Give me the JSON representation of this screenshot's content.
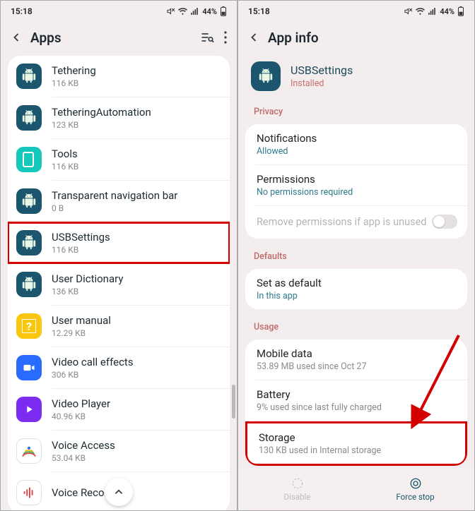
{
  "status": {
    "time": "15:18",
    "battery": "44%"
  },
  "left": {
    "title": "Apps",
    "apps": [
      {
        "name": "Tethering",
        "sub": "116 KB",
        "iconType": "android"
      },
      {
        "name": "TetheringAutomation",
        "sub": "123 KB",
        "iconType": "android"
      },
      {
        "name": "Tools",
        "sub": "116 KB",
        "iconType": "tools"
      },
      {
        "name": "Transparent navigation bar",
        "sub": "0 B",
        "iconType": "android"
      },
      {
        "name": "USBSettings",
        "sub": "116 KB",
        "iconType": "android",
        "highlight": true
      },
      {
        "name": "User Dictionary",
        "sub": "136 KB",
        "iconType": "android"
      },
      {
        "name": "User manual",
        "sub": "12.29 KB",
        "iconType": "um"
      },
      {
        "name": "Video call effects",
        "sub": "306 KB",
        "iconType": "vc"
      },
      {
        "name": "Video Player",
        "sub": "40.96 KB",
        "iconType": "vp"
      },
      {
        "name": "Voice Access",
        "sub": "53.04 KB",
        "iconType": "va"
      },
      {
        "name": "Voice Recorder",
        "sub": "",
        "iconType": "vr"
      }
    ]
  },
  "right": {
    "title": "App info",
    "app": {
      "name": "USBSettings",
      "status": "Installed"
    },
    "sections": {
      "privacy": {
        "label": "Privacy",
        "notifications": {
          "title": "Notifications",
          "sub": "Allowed"
        },
        "permissions": {
          "title": "Permissions",
          "sub": "No permissions required"
        },
        "remove": "Remove permissions if app is unused"
      },
      "defaults": {
        "label": "Defaults",
        "setdefault": {
          "title": "Set as default",
          "sub": "In this app"
        }
      },
      "usage": {
        "label": "Usage",
        "mobile": {
          "title": "Mobile data",
          "sub": "53.89 MB used since Oct 27"
        },
        "battery": {
          "title": "Battery",
          "sub": "9% used since last fully charged"
        },
        "storage": {
          "title": "Storage",
          "sub": "130 KB used in Internal storage",
          "highlight": true
        }
      }
    },
    "buttons": {
      "disable": "Disable",
      "forcestop": "Force stop"
    }
  }
}
